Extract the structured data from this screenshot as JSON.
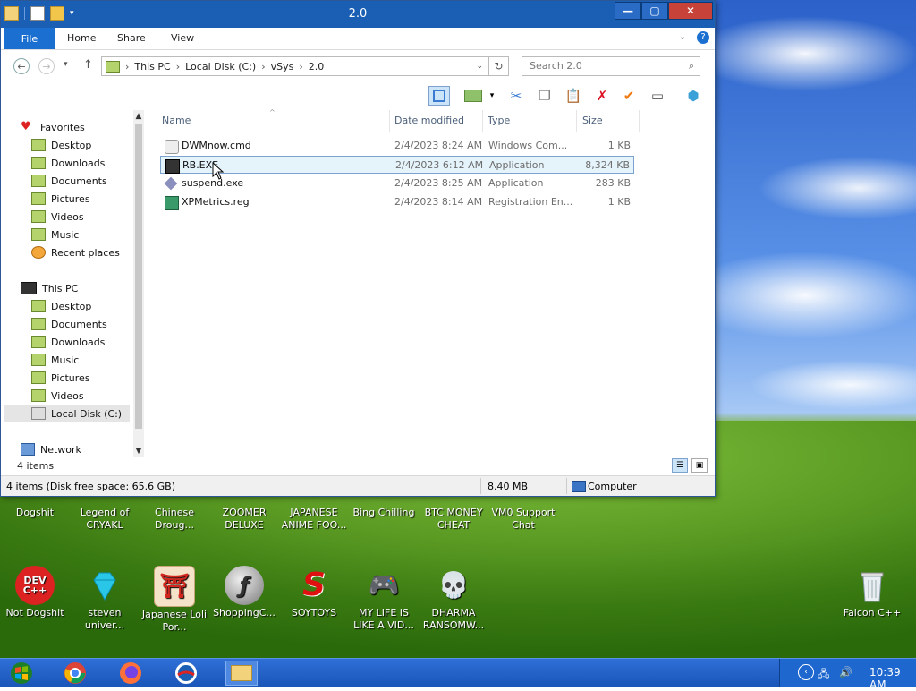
{
  "window": {
    "title": "2.0",
    "controls": {
      "minimize": "—",
      "maximize": "▢",
      "close": "✕"
    }
  },
  "ribbon": {
    "tabs": [
      "File",
      "Home",
      "Share",
      "View"
    ]
  },
  "address": {
    "path": [
      "This PC",
      "Local Disk (C:)",
      "vSys",
      "2.0"
    ],
    "search_placeholder": "Search 2.0"
  },
  "nav": {
    "favorites_label": "Favorites",
    "favorites": [
      "Desktop",
      "Downloads",
      "Documents",
      "Pictures",
      "Videos",
      "Music",
      "Recent places"
    ],
    "thispc_label": "This PC",
    "thispc": [
      "Desktop",
      "Documents",
      "Downloads",
      "Music",
      "Pictures",
      "Videos",
      "Local Disk (C:)"
    ],
    "network_label": "Network"
  },
  "columns": {
    "name": "Name",
    "date": "Date modified",
    "type": "Type",
    "size": "Size"
  },
  "files": [
    {
      "name": "DWMnow.cmd",
      "date": "2/4/2023 8:24 AM",
      "type": "Windows Com...",
      "size": "1 KB"
    },
    {
      "name": "RB.EXE",
      "date": "2/4/2023 6:12 AM",
      "type": "Application",
      "size": "8,324 KB"
    },
    {
      "name": "suspend.exe",
      "date": "2/4/2023 8:25 AM",
      "type": "Application",
      "size": "283 KB"
    },
    {
      "name": "XPMetrics.reg",
      "date": "2/4/2023 8:14 AM",
      "type": "Registration En...",
      "size": "1 KB"
    }
  ],
  "items_count": "4 items",
  "status": {
    "left": "4 items (Disk free space: 65.6 GB)",
    "size": "8.40 MB",
    "location": "Computer"
  },
  "desktop_icons_row1": [
    "Dogshit",
    "Legend of CRYAKL",
    "Chinese Droug...",
    "ZOOMER DELUXE",
    "JAPANESE ANIME FOO...",
    "Bing Chilling",
    "BTC MONEY CHEAT",
    "VM0 Support Chat"
  ],
  "desktop_icons_row2": [
    "Not Dogshit",
    "steven univer...",
    "Japanese Loli Por...",
    "ShoppingC...",
    "SOYTOYS",
    "MY LIFE IS LIKE A VID...",
    "DHARMA RANSOMW..."
  ],
  "desktop_icon_right": "Falcon C++",
  "devcpp_text": "DEV C++",
  "clock": "10:39 AM",
  "colors": {
    "accent": "#1a6fd1",
    "titlebar": "#1a5fb4",
    "taskbar": "#1a55b8"
  }
}
